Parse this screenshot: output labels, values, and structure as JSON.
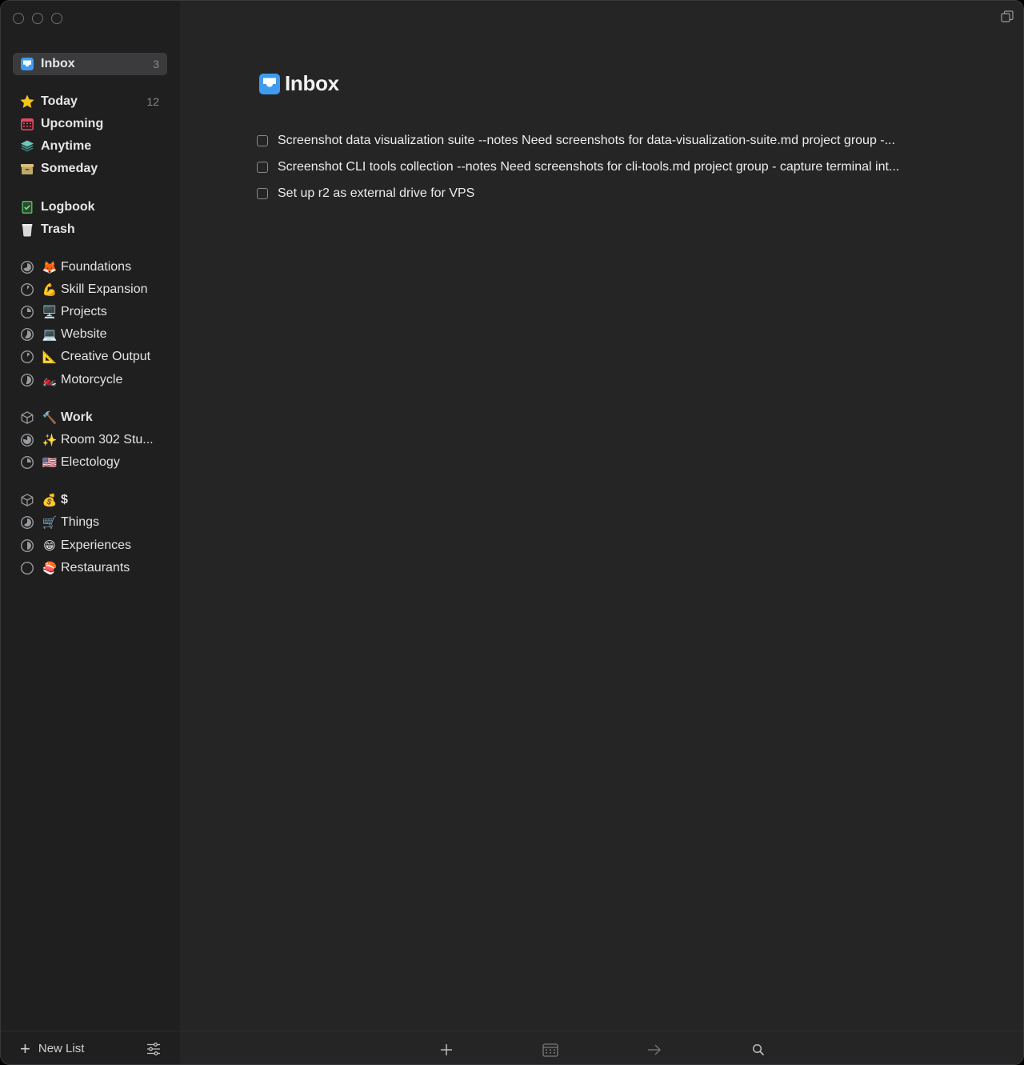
{
  "sidebar": {
    "inbox": {
      "label": "Inbox",
      "count": "3",
      "icon": "inbox-tray-icon"
    },
    "smart_lists": [
      {
        "label": "Today",
        "count": "12",
        "icon": "star-icon"
      },
      {
        "label": "Upcoming",
        "count": "",
        "icon": "calendar-icon"
      },
      {
        "label": "Anytime",
        "count": "",
        "icon": "layers-icon"
      },
      {
        "label": "Someday",
        "count": "",
        "icon": "archive-box-icon"
      }
    ],
    "log_lists": [
      {
        "label": "Logbook",
        "icon": "logbook-check-icon"
      },
      {
        "label": "Trash",
        "icon": "trash-bin-icon"
      }
    ],
    "projects": [
      {
        "label": "Foundations",
        "emoji": "🦊",
        "progress": 0.7
      },
      {
        "label": "Skill Expansion",
        "emoji": "💪",
        "progress": 0.1
      },
      {
        "label": "Projects",
        "emoji": "🖥️",
        "progress": 0.25
      },
      {
        "label": "Website",
        "emoji": "💻",
        "progress": 0.6
      },
      {
        "label": "Creative Output",
        "emoji": "📐",
        "progress": 0.12
      },
      {
        "label": "Motorcycle",
        "emoji": "🏍️",
        "progress": 0.55
      }
    ],
    "areas": [
      {
        "label": "Work",
        "emoji": "🔨",
        "projects": [
          {
            "label": "Room 302 Stu...",
            "emoji": "✨",
            "progress": 0.8
          },
          {
            "label": "Electology",
            "emoji": "🇺🇸",
            "progress": 0.25
          }
        ]
      },
      {
        "label": "$",
        "emoji": "💰",
        "projects": [
          {
            "label": "Things",
            "emoji": "🛒",
            "progress": 0.65
          },
          {
            "label": "Experiences",
            "emoji": "😁",
            "progress": 0.5
          },
          {
            "label": "Restaurants",
            "emoji": "🍣",
            "progress": 0
          }
        ]
      }
    ],
    "footer": {
      "new_list_label": "New List"
    }
  },
  "main": {
    "title": "Inbox",
    "tasks": [
      {
        "text": "Screenshot data visualization suite --notes Need screenshots for data-visualization-suite.md project group -..."
      },
      {
        "text": "Screenshot CLI tools collection --notes Need screenshots for cli-tools.md project group - capture terminal int..."
      },
      {
        "text": "Set up r2 as external drive for VPS"
      }
    ]
  },
  "colors": {
    "inbox_blue": "#3e9cf0",
    "sidebar_bg": "#1f1f20",
    "main_bg": "#252526",
    "selected_bg": "#3b3b3e"
  }
}
